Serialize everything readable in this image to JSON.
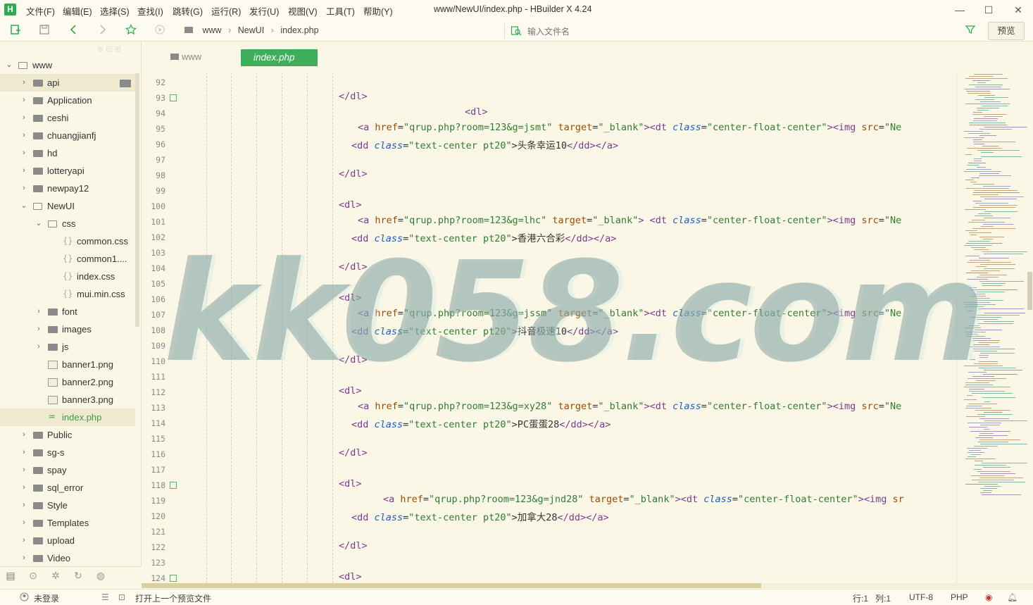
{
  "titlebar": {
    "logo": "H",
    "menu": [
      "文件(F)",
      "编辑(E)",
      "选择(S)",
      "查找(I)",
      "跳转(G)",
      "运行(R)",
      "发行(U)",
      "视图(V)",
      "工具(T)",
      "帮助(Y)"
    ],
    "window_title": "www/NewUI/index.php - HBuilder X 4.24",
    "minimize": "—",
    "maximize": "☐",
    "close": "✕"
  },
  "toolbar": {
    "breadcrumb": [
      "www",
      "NewUI",
      "index.php"
    ],
    "search_placeholder": "输入文件名",
    "preview_label": "预览"
  },
  "sidebar": {
    "root": "www",
    "items": [
      {
        "label": "api"
      },
      {
        "label": "Application"
      },
      {
        "label": "ceshi"
      },
      {
        "label": "chuangjianfj"
      },
      {
        "label": "hd"
      },
      {
        "label": "lotteryapi"
      },
      {
        "label": "newpay12"
      },
      {
        "label": "NewUI"
      },
      {
        "label": "css"
      },
      {
        "label": "common.css"
      },
      {
        "label": "common1...."
      },
      {
        "label": "index.css"
      },
      {
        "label": "mui.min.css"
      },
      {
        "label": "font"
      },
      {
        "label": "images"
      },
      {
        "label": "js"
      },
      {
        "label": "banner1.png"
      },
      {
        "label": "banner2.png"
      },
      {
        "label": "banner3.png"
      },
      {
        "label": "index.php"
      },
      {
        "label": "Public"
      },
      {
        "label": "sg-s"
      },
      {
        "label": "spay"
      },
      {
        "label": "sql_error"
      },
      {
        "label": "Style"
      },
      {
        "label": "Templates"
      },
      {
        "label": "upload"
      },
      {
        "label": "Video"
      }
    ]
  },
  "tabs": {
    "folder": "www",
    "active": "index.php"
  },
  "editor": {
    "line_numbers": [
      "92",
      "93",
      "94",
      "95",
      "96",
      "97",
      "98",
      "99",
      "100",
      "101",
      "102",
      "103",
      "104",
      "105",
      "106",
      "107",
      "108",
      "109",
      "110",
      "111",
      "112",
      "113",
      "114",
      "115",
      "116",
      "117",
      "118",
      "119",
      "120",
      "121",
      "122",
      "123",
      "124"
    ],
    "lines": {
      "l93": "</dl>",
      "l94": "<dl>",
      "l95_a": "<a ",
      "l95_href": "href",
      "l95_hv": "\"qrup.php?room=123&g=jsmt\"",
      "l95_t": " target",
      "l95_tv": "\"_blank\"",
      "l95_dt": "><dt ",
      "l95_cls": "class",
      "l95_cv": "\"center-float-center\"",
      "l95_img": "><img ",
      "l95_src": "src",
      "l95_sv": "\"Ne",
      "l96_dd": "<dd ",
      "l96_cls": "class",
      "l96_cv": "\"text-center pt20\"",
      "l96_txt": ">头条幸运10",
      "l96_end": "</dd></a>",
      "l98": "</dl>",
      "l100": "<dl>",
      "l101_a": "<a ",
      "l101_href": "href",
      "l101_hv": "\"qrup.php?room=123&g=lhc\"",
      "l101_t": " target",
      "l101_tv": "\"_blank\"",
      "l101_dt": "> <dt ",
      "l101_cls": "class",
      "l101_cv": "\"center-float-center\"",
      "l101_img": "><img ",
      "l101_src": "src",
      "l101_sv": "\"Ne",
      "l102_dd": "<dd ",
      "l102_cls": "class",
      "l102_cv": "\"text-center pt20\"",
      "l102_txt": ">香港六合彩",
      "l102_end": "</dd></a>",
      "l104": "</dl>",
      "l106": "<dl>",
      "l107_a": "<a ",
      "l107_href": "href",
      "l107_hv": "\"qrup.php?room=123&g=jssm\"",
      "l107_t": " target",
      "l107_tv": "\"_blank\"",
      "l107_dt": "><dt ",
      "l107_cls": "class",
      "l107_cv": "\"center-float-center\"",
      "l107_img": "><img ",
      "l107_src": "src",
      "l107_sv": "\"Ne",
      "l108_dd": "<dd ",
      "l108_cls": "class",
      "l108_cv": "\"text-center pt20\"",
      "l108_txt": ">抖音极速10",
      "l108_end": "</dd></a>",
      "l110": "</dl>",
      "l112": "<dl>",
      "l113_a": "<a ",
      "l113_href": "href",
      "l113_hv": "\"qrup.php?room=123&g=xy28\"",
      "l113_t": " target",
      "l113_tv": "\"_blank\"",
      "l113_dt": "><dt ",
      "l113_cls": "class",
      "l113_cv": "\"center-float-center\"",
      "l113_img": "><img ",
      "l113_src": "src",
      "l113_sv": "\"Ne",
      "l114_dd": "<dd ",
      "l114_cls": "class",
      "l114_cv": "\"text-center pt20\"",
      "l114_txt": ">PC蛋蛋28",
      "l114_end": "</dd></a>",
      "l116": "</dl>",
      "l118": "<dl>",
      "l119_a": "<a ",
      "l119_href": "href",
      "l119_hv": "\"qrup.php?room=123&g=jnd28\"",
      "l119_t": " target",
      "l119_tv": "\"_blank\"",
      "l119_dt": "><dt ",
      "l119_cls": "class",
      "l119_cv": "\"center-float-center\"",
      "l119_img": "><img ",
      "l119_src": "sr",
      "l120_dd": "<dd ",
      "l120_cls": "class",
      "l120_cv": "\"text-center pt20\"",
      "l120_txt": ">加拿大28",
      "l120_end": "</dd></a>",
      "l122": "</dl>",
      "l124": "<dl>"
    }
  },
  "watermark": "kk058.com",
  "statusbar": {
    "login": "未登录",
    "preview_hint": "打开上一个预览文件",
    "position_row": "行:1",
    "position_col": "列:1",
    "encoding": "UTF-8",
    "language": "PHP"
  }
}
